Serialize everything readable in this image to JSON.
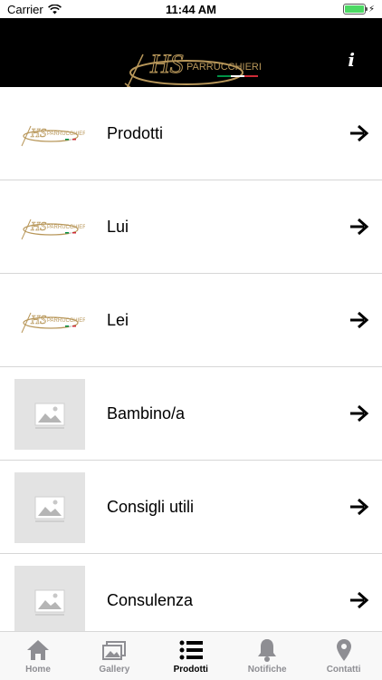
{
  "status_bar": {
    "carrier": "Carrier",
    "time": "11:44 AM",
    "battery_level": 1.0
  },
  "header": {
    "logo_text": "HS",
    "logo_subtext": "PARRUCCHIERI",
    "info_label": "i"
  },
  "list": {
    "items": [
      {
        "label": "Prodotti",
        "thumb": "logo"
      },
      {
        "label": "Lui",
        "thumb": "logo"
      },
      {
        "label": "Lei",
        "thumb": "logo"
      },
      {
        "label": "Bambino/a",
        "thumb": "placeholder"
      },
      {
        "label": "Consigli utili",
        "thumb": "placeholder"
      },
      {
        "label": "Consulenza",
        "thumb": "placeholder"
      }
    ]
  },
  "tabs": [
    {
      "label": "Home",
      "icon": "home-icon"
    },
    {
      "label": "Gallery",
      "icon": "gallery-icon"
    },
    {
      "label": "Prodotti",
      "icon": "list-icon",
      "active": true
    },
    {
      "label": "Notifiche",
      "icon": "bell-icon"
    },
    {
      "label": "Contatti",
      "icon": "location-pin-icon"
    }
  ],
  "colors": {
    "header_bg": "#000000",
    "logo_gold": "#b8975a",
    "tab_inactive": "#8e8e93",
    "tab_active": "#000000",
    "italy_green": "#009246",
    "italy_red": "#ce2b37"
  }
}
